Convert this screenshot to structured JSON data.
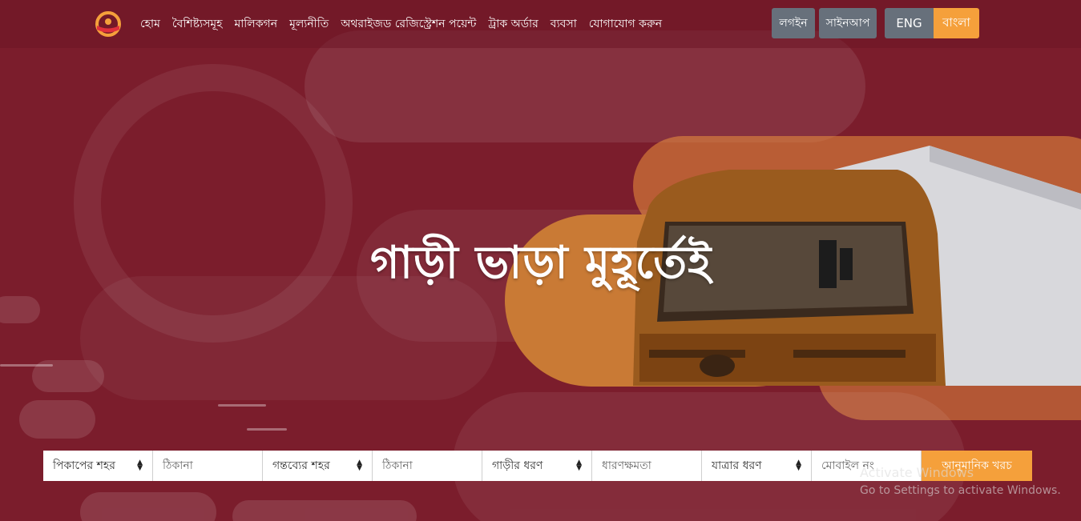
{
  "nav": {
    "logo_icon": "truck-wheel-logo",
    "links": [
      "হোম",
      "বৈশিষ্ট্যসমূহ",
      "মালিকগন",
      "মূল্যনীতি",
      "অথরাইজড রেজিস্ট্রেশন পয়েন্ট",
      "ট্রাক অর্ডার",
      "ব্যবসা",
      "যোগাযোগ করুন"
    ],
    "login_label": "লগইন",
    "signup_label": "সাইনআপ",
    "lang_eng": "ENG",
    "lang_bn": "বাংলা"
  },
  "hero": {
    "title": "গাড়ী ভাড়া মুহূর্তেই"
  },
  "search": {
    "pickup_city": "পিকাপের শহর",
    "pickup_address_placeholder": "ঠিকানা",
    "destination_city": "গন্তব্যের শহর",
    "destination_address_placeholder": "ঠিকানা",
    "vehicle_type": "গাড়ীর ধরণ",
    "capacity_placeholder": "ধারণক্ষমতা",
    "trip_type": "যাত্রার ধরণ",
    "mobile_placeholder": "মোবাইল নং",
    "submit_label": "আনুমানিক খরচ"
  },
  "watermark": {
    "line1": "Activate Windows",
    "line2": "Go to Settings to activate Windows."
  },
  "colors": {
    "background": "#7b1d2c",
    "accent": "#f5a03b",
    "button_gray": "#67707b"
  }
}
